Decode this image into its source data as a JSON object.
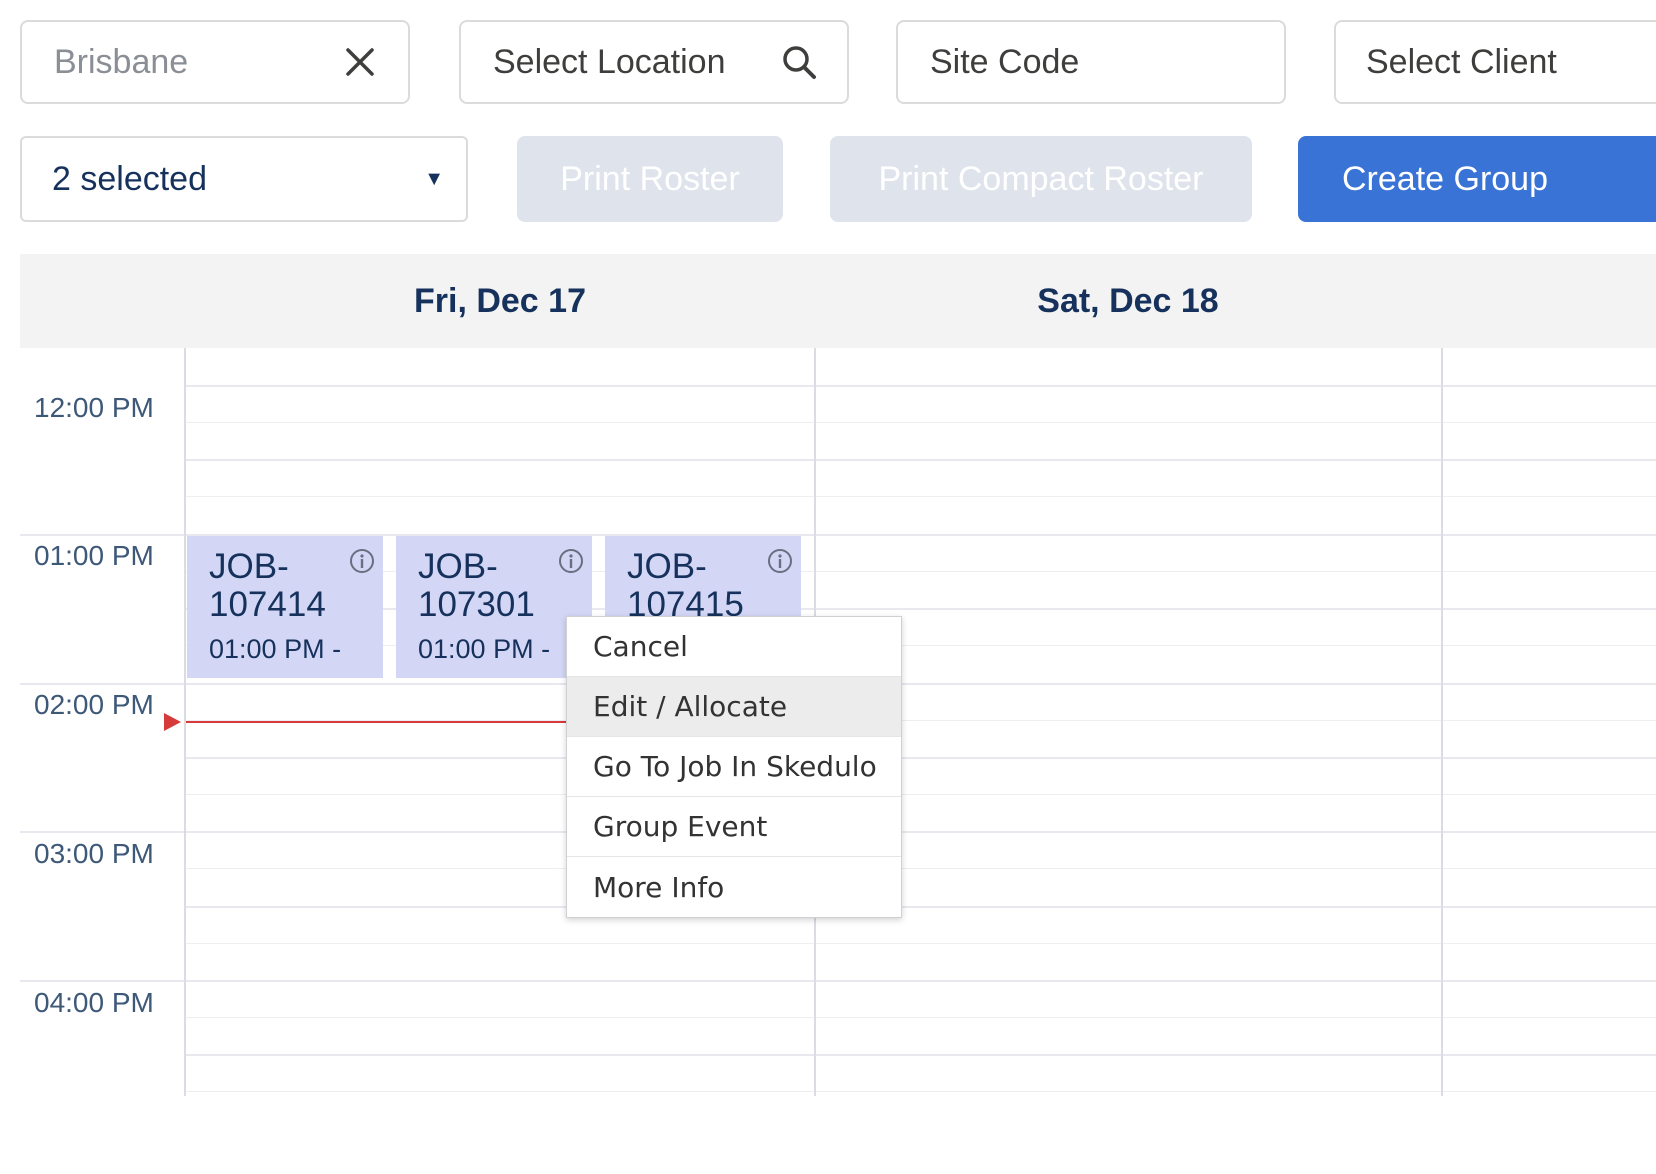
{
  "filters": {
    "region": {
      "value": "Brisbane",
      "icon": "close-icon"
    },
    "location": {
      "placeholder": "Select Location",
      "icon": "search-icon"
    },
    "site_code": {
      "placeholder": "Site Code"
    },
    "client": {
      "placeholder": "Select Client"
    }
  },
  "toolbar": {
    "multiselect_value": "2 selected",
    "print_roster": "Print Roster",
    "print_compact_roster": "Print Compact Roster",
    "create_group": "Create Group"
  },
  "calendar": {
    "days": [
      "Fri, Dec 17",
      "Sat, Dec 18"
    ],
    "times": [
      "12:00 PM",
      "01:00 PM",
      "02:00 PM",
      "03:00 PM",
      "04:00 PM"
    ],
    "events": [
      {
        "id": "JOB-107414",
        "time": "01:00 PM -"
      },
      {
        "id": "JOB-107301",
        "time": "01:00 PM -"
      },
      {
        "id": "JOB-107415",
        "time": ""
      }
    ]
  },
  "context_menu": {
    "items": [
      "Cancel",
      "Edit / Allocate",
      "Go To Job In Skedulo",
      "Group Event",
      "More Info"
    ],
    "highlighted": "Edit / Allocate"
  },
  "colors": {
    "primary": "#3973d6",
    "disabled": "#dfe4ec",
    "event_bg": "#d3d7f5",
    "now_indicator": "#d63b3b"
  }
}
